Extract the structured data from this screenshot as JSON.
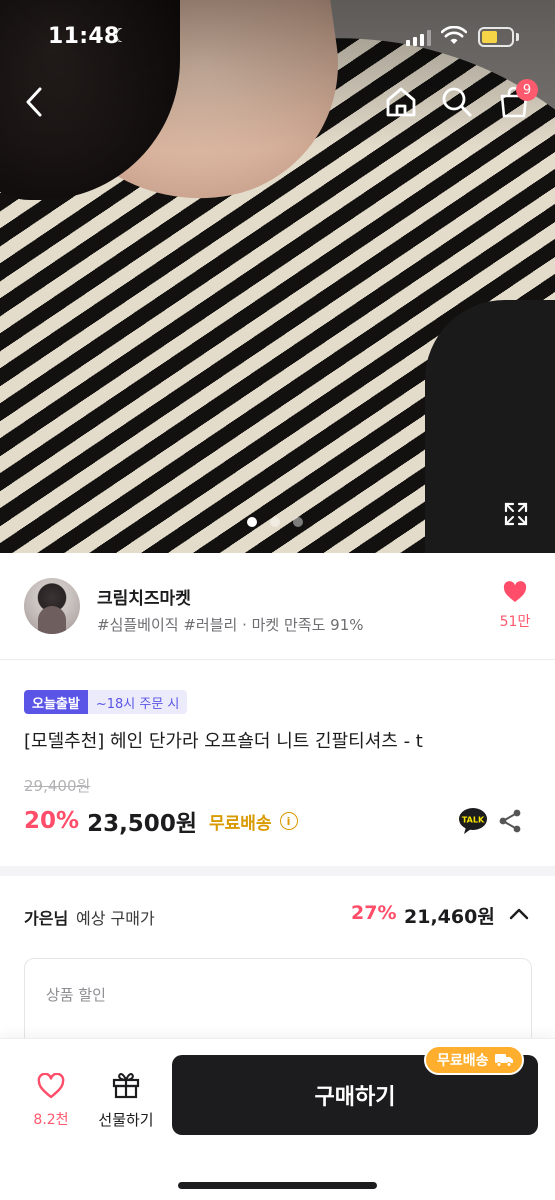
{
  "status_bar": {
    "time": "11:48",
    "battery_level": 0.55,
    "battery_color": "#f5d547"
  },
  "header": {
    "back_icon": "chevron-left-icon",
    "home_icon": "home-icon",
    "search_icon": "search-icon",
    "cart_icon": "shopping-bag-icon",
    "cart_count": "9"
  },
  "gallery": {
    "pages": 3,
    "current_page": 1,
    "expand_icon": "expand-icon"
  },
  "shop": {
    "name": "크림치즈마켓",
    "tags": "#심플베이직 #러블리 · 마켓 만족도 91%",
    "like_count": "51만"
  },
  "product": {
    "badge_today": "오늘출발",
    "badge_time": "~18시 주문 시",
    "title": "[모델추천] 헤인 단가라 오프숄더 니트 긴팔티셔츠 - t",
    "original_price": "29,400원",
    "discount": "20%",
    "price": "23,500원",
    "free_shipping": "무료배송",
    "info_icon": "i"
  },
  "estimate": {
    "name": "가은님",
    "label": "예상 구매가",
    "discount": "27%",
    "price": "21,460원"
  },
  "discount_card": {
    "title": "상품 할인"
  },
  "bottom_bar": {
    "like_label": "8.2천",
    "gift_label": "선물하기",
    "buy_label": "구매하기",
    "free_shipping_tag": "무료배송"
  },
  "colors": {
    "accent_pink": "#ff4d6a",
    "brand_purple": "#5a55e6",
    "shipping_gold": "#d99a00",
    "button_dark": "#1c1c1e"
  }
}
